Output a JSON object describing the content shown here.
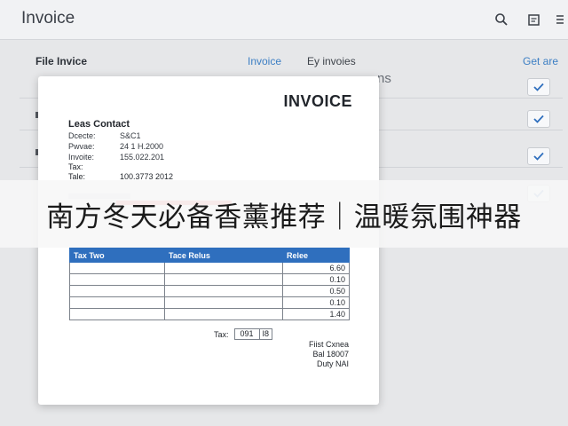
{
  "app": {
    "title": "Invoice"
  },
  "toolbar": {
    "icons": [
      "search-icon",
      "document-icon",
      "menu-icon"
    ]
  },
  "list": {
    "headers": {
      "file": "File Invice",
      "invoice": "Invoice",
      "by": "Ey invoies",
      "get": "Get are"
    },
    "row_text_fragment": "ns",
    "checked_rows": [
      true,
      true,
      true,
      true
    ]
  },
  "invoice": {
    "title": "INVOICE",
    "contact_heading": "Leas Contact",
    "meta": [
      {
        "k": "Dcecte:",
        "v": "S&C1"
      },
      {
        "k": "Pwvae:",
        "v": "24 1 H.2000"
      },
      {
        "k": "Invoite:",
        "v": "155.022.201"
      }
    ],
    "tax_label": "Tax:",
    "tale_label": "Tale:",
    "tale_value": "100.3773 2012",
    "table": {
      "headers": [
        "Tax   Two",
        "Tace Relus",
        "Relee"
      ],
      "rows": [
        [
          "",
          "",
          "6.60"
        ],
        [
          "",
          "",
          "0.10"
        ],
        [
          "",
          "",
          "0.50"
        ],
        [
          "",
          "",
          "0.10"
        ],
        [
          "",
          "",
          "1.40"
        ]
      ]
    },
    "tax_sum": {
      "label": "Tax:",
      "value": "091",
      "extra": "I8"
    },
    "footer": [
      "Fiist Cxnea",
      "Bal 18007",
      "Duty NAI"
    ]
  },
  "banner": {
    "text": "南方冬天必备香薰推荐｜温暖氛围神器"
  },
  "colors": {
    "accent": "#3d7fc4",
    "table_header": "#2f6fbe",
    "stripe": "#f08a8a"
  }
}
